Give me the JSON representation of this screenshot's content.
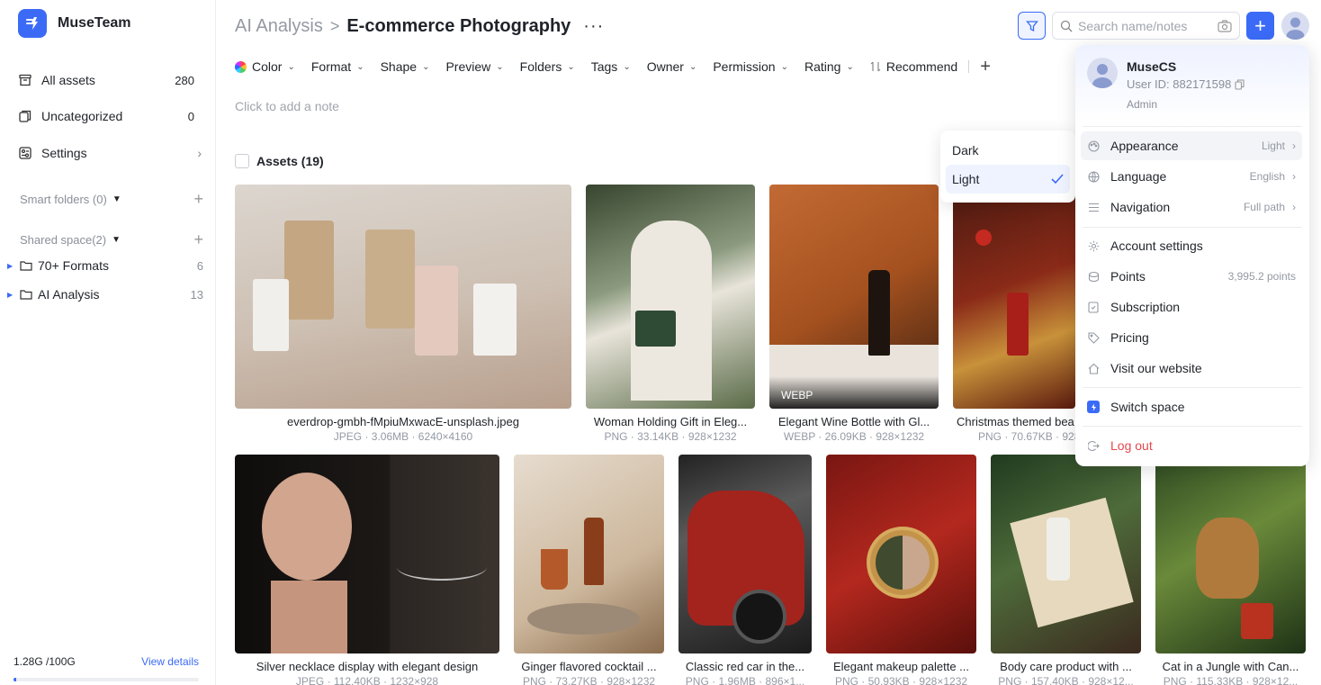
{
  "brand": {
    "name": "MuseTeam"
  },
  "sidebar": {
    "nav": [
      {
        "label": "All assets",
        "count": "280"
      },
      {
        "label": "Uncategorized",
        "count": "0"
      },
      {
        "label": "Settings"
      }
    ],
    "smart_folders": "Smart folders (0)",
    "shared_space": "Shared space(2)",
    "folders": [
      {
        "label": "70+ Formats",
        "count": "6"
      },
      {
        "label": "AI Analysis",
        "count": "13"
      }
    ],
    "storage": {
      "used": "1.28G /100G",
      "view_details": "View details",
      "fill_fraction": 0.013
    }
  },
  "header": {
    "breadcrumb_parent": "AI Analysis",
    "breadcrumb_sep": ">",
    "breadcrumb_current": "E-commerce Photography",
    "more": "···",
    "search_placeholder": "Search name/notes",
    "add": "+"
  },
  "filters": [
    "Color",
    "Format",
    "Shape",
    "Preview",
    "Folders",
    "Tags",
    "Owner",
    "Permission",
    "Rating"
  ],
  "recommend": "Recommend",
  "note_placeholder": "Click to add a note",
  "assets_label": "Assets (19)",
  "assets": [
    {
      "name": "everdrop-gmbh-fMpiuMxwacE-unsplash.jpeg",
      "meta": "JPEG · 3.06MB · 6240×4160",
      "badge": ""
    },
    {
      "name": "Woman Holding Gift in Eleg...",
      "meta": "PNG · 33.14KB · 928×1232",
      "badge": ""
    },
    {
      "name": "Elegant Wine Bottle with Gl...",
      "meta": "WEBP · 26.09KB · 928×1232",
      "badge": "WEBP"
    },
    {
      "name": "Christmas themed bea",
      "meta": "PNG · 70.67KB · 928",
      "badge": ""
    },
    {
      "name": "Silver necklace display with elegant design",
      "meta": "JPEG · 112.40KB · 1232×928",
      "badge": ""
    },
    {
      "name": "Ginger flavored cocktail ...",
      "meta": "PNG · 73.27KB · 928×1232",
      "badge": ""
    },
    {
      "name": "Classic red car in the...",
      "meta": "PNG · 1.96MB · 896×1...",
      "badge": ""
    },
    {
      "name": "Elegant makeup palette ...",
      "meta": "PNG · 50.93KB · 928×1232",
      "badge": ""
    },
    {
      "name": "Body care product with ...",
      "meta": "PNG · 157.40KB · 928×12...",
      "badge": ""
    },
    {
      "name": "Cat in a Jungle with Can...",
      "meta": "PNG · 115.33KB · 928×12...",
      "badge": ""
    }
  ],
  "theme_menu": {
    "options": [
      "Dark",
      "Light"
    ],
    "selected": "Light"
  },
  "account_menu": {
    "name": "MuseCS",
    "user_id": "User ID: 882171598",
    "role": "Admin",
    "appearance": {
      "label": "Appearance",
      "value": "Light"
    },
    "language": {
      "label": "Language",
      "value": "English"
    },
    "navigation": {
      "label": "Navigation",
      "value": "Full path"
    },
    "account_settings": "Account settings",
    "points": {
      "label": "Points",
      "value": "3,995.2 points"
    },
    "subscription": "Subscription",
    "pricing": "Pricing",
    "visit_website": "Visit our website",
    "switch_space": "Switch space",
    "logout": "Log out"
  },
  "colors": {
    "accent": "#3b6bf6",
    "danger": "#e5484d"
  }
}
